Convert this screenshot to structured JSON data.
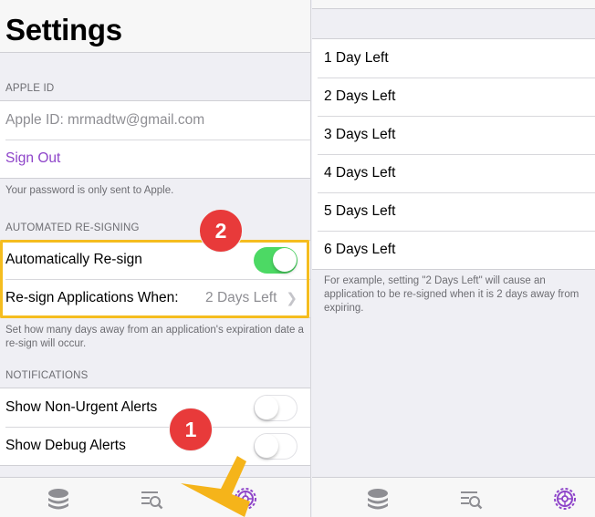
{
  "left": {
    "title": "Settings",
    "apple_id_header": "APPLE ID",
    "apple_id_row": "Apple ID: mrmadtw@gmail.com",
    "sign_out": "Sign Out",
    "password_note": "Your password is only sent to Apple.",
    "resign_header": "AUTOMATED RE-SIGNING",
    "auto_resign_label": "Automatically Re-sign",
    "auto_resign_on": true,
    "resign_when_label": "Re-sign Applications When:",
    "resign_when_value": "2 Days Left",
    "resign_note": "Set how many days away from an application's expiration date a re-sign will occur.",
    "notifications_header": "NOTIFICATIONS",
    "non_urgent_label": "Show Non-Urgent Alerts",
    "non_urgent_on": false,
    "debug_label": "Show Debug Alerts",
    "debug_on": false
  },
  "right": {
    "options": [
      "1 Day Left",
      "2 Days Left",
      "3 Days Left",
      "4 Days Left",
      "5 Days Left",
      "6 Days Left"
    ],
    "example_note": "For example, setting \"2 Days Left\" will cause an application to be re-signed when it is 2 days away from expiring."
  },
  "annotations": {
    "badge_1": "1",
    "badge_2": "2",
    "highlight_color": "#f5bd1f",
    "badge_color": "#e83a3a"
  },
  "tabbar": {
    "tabs": [
      "layers-icon",
      "search-list-icon",
      "gear-icon"
    ],
    "active_tab": "gear-icon",
    "active_color": "#8e44c9"
  }
}
